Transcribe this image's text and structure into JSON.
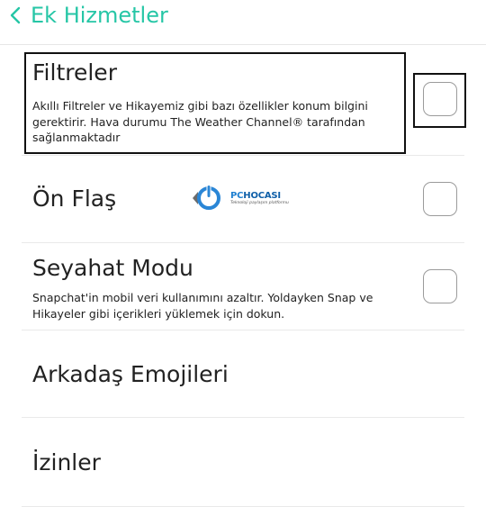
{
  "header": {
    "back_icon": "chevron-left-icon",
    "title": "Ek Hizmetler"
  },
  "colors": {
    "accent": "#26c6a6",
    "checkbox_border": "#9b9b9b",
    "divider": "#e9e9e9"
  },
  "rows": [
    {
      "title": "Filtreler",
      "description": "Akıllı Filtreler ve Hikayemiz gibi bazı özellikler konum bilgini gerektirir. Hava durumu The Weather Channel® tarafından sağlanmaktadır",
      "checked": false
    },
    {
      "title": "Ön Flaş",
      "checked": false
    },
    {
      "title": "Seyahat Modu",
      "description": "Snapchat'in mobil veri kullanımını azaltır. Yoldayken Snap ve Hikayeler gibi içerikleri yüklemek için dokun.",
      "checked": false
    },
    {
      "title": "Arkadaş Emojileri"
    },
    {
      "title": "İzinler"
    }
  ],
  "watermark": {
    "logo_icon": "power-icon",
    "name_pc": "PC",
    "name_rest": "HOCASI",
    "tagline": "Teknoloji paylaşım platformu"
  }
}
